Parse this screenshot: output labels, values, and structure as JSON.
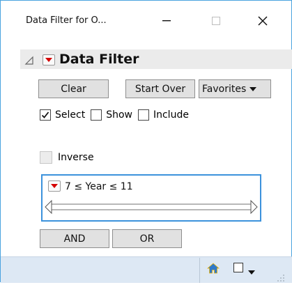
{
  "window": {
    "title": "Data Filter for O...",
    "controls": {
      "minimize_icon": "minimize-icon",
      "maximize_icon": "maximize-icon",
      "close_icon": "close-icon"
    }
  },
  "panel": {
    "header_title": "Data Filter",
    "disclosure_icon": "disclosure-triangle-icon",
    "menu_icon": "red-triangle-menu-icon"
  },
  "buttons": {
    "clear": "Clear",
    "start_over": "Start Over",
    "favorites": "Favorites",
    "and": "AND",
    "or": "OR"
  },
  "mode": {
    "select_label": "Select",
    "select_checked": true,
    "show_label": "Show",
    "show_checked": false,
    "include_label": "Include",
    "include_checked": false
  },
  "inverse": {
    "label": "Inverse",
    "checked": false,
    "enabled": false
  },
  "filter": {
    "condition_text": "7 ≤ Year  ≤ 11",
    "lower": 7,
    "upper": 11,
    "column": "Year"
  },
  "statusbar": {
    "icons": [
      "home-icon",
      "checkbox-icon",
      "dropdown-caret-icon",
      "resize-grip-icon"
    ]
  },
  "colors": {
    "focus_border": "#3c92dc",
    "menu_triangle": "#d40000",
    "statusbar_bg": "#dde8f4",
    "header_bg": "#ebebeb",
    "home_icon": "#2f79c8"
  }
}
